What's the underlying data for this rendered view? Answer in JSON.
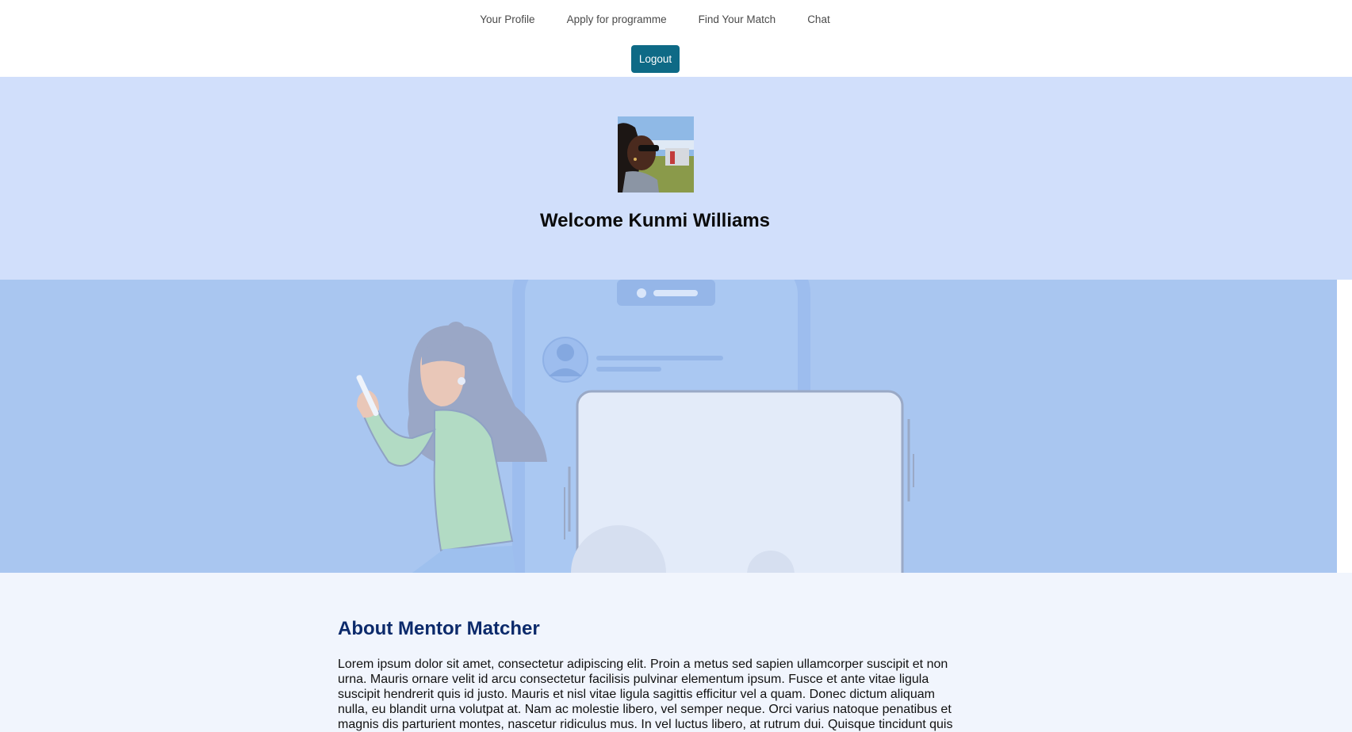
{
  "nav": {
    "items": [
      {
        "label": "Your Profile"
      },
      {
        "label": "Apply for programme"
      },
      {
        "label": "Find Your Match"
      },
      {
        "label": "Chat"
      }
    ],
    "logout_label": "Logout"
  },
  "hero": {
    "welcome": "Welcome Kunmi Williams"
  },
  "about": {
    "title": "About Mentor Matcher",
    "body": "Lorem ipsum dolor sit amet, consectetur adipiscing elit. Proin a metus sed sapien ullamcorper suscipit et non urna. Mauris ornare velit id arcu consectetur facilisis pulvinar elementum ipsum. Fusce et ante vitae ligula suscipit hendrerit quis id justo. Mauris et nisl vitae ligula sagittis efficitur vel a quam. Donec dictum aliquam nulla, eu blandit urna volutpat at. Nam ac molestie libero, vel semper neque. Orci varius natoque penatibus et magnis dis parturient montes, nascetur ridiculus mus. In vel luctus libero, at rutrum dui. Quisque tincidunt quis"
  },
  "colors": {
    "accent": "#0e6a86",
    "hero_bg": "#d1dffb",
    "illustration_bg": "#a9c6f0",
    "about_bg": "#f1f5fd",
    "heading": "#0c2a6b"
  }
}
